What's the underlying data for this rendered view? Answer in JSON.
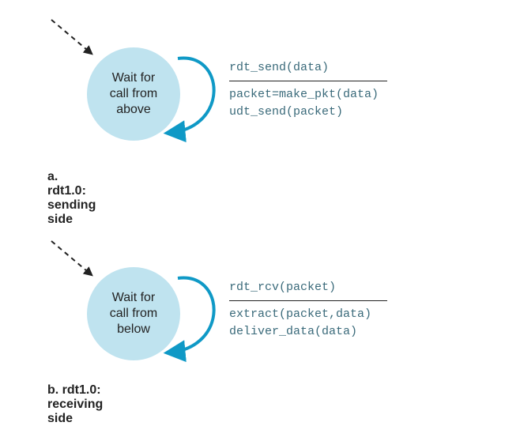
{
  "colors": {
    "state_fill": "#bfe3ef",
    "arrow_stroke": "#0f99c6",
    "code_text": "#3a6a7a"
  },
  "sender": {
    "state_line1": "Wait for",
    "state_line2": "call from",
    "state_line3": "above",
    "event": "rdt_send(data)",
    "action1": "packet=make_pkt(data)",
    "action2": "udt_send(packet)",
    "caption": "a.  rdt1.0: sending side"
  },
  "receiver": {
    "state_line1": "Wait for",
    "state_line2": "call from",
    "state_line3": "below",
    "event": "rdt_rcv(packet)",
    "action1": "extract(packet,data)",
    "action2": "deliver_data(data)",
    "caption": "b.  rdt1.0: receiving side"
  },
  "chart_data": [
    {
      "type": "fsm",
      "title": "rdt1.0: sending side",
      "states": [
        {
          "id": "wait_above",
          "label": "Wait for call from above",
          "initial": true
        }
      ],
      "transitions": [
        {
          "from": "wait_above",
          "to": "wait_above",
          "event": "rdt_send(data)",
          "actions": [
            "packet=make_pkt(data)",
            "udt_send(packet)"
          ]
        }
      ]
    },
    {
      "type": "fsm",
      "title": "rdt1.0: receiving side",
      "states": [
        {
          "id": "wait_below",
          "label": "Wait for call from below",
          "initial": true
        }
      ],
      "transitions": [
        {
          "from": "wait_below",
          "to": "wait_below",
          "event": "rdt_rcv(packet)",
          "actions": [
            "extract(packet,data)",
            "deliver_data(data)"
          ]
        }
      ]
    }
  ]
}
